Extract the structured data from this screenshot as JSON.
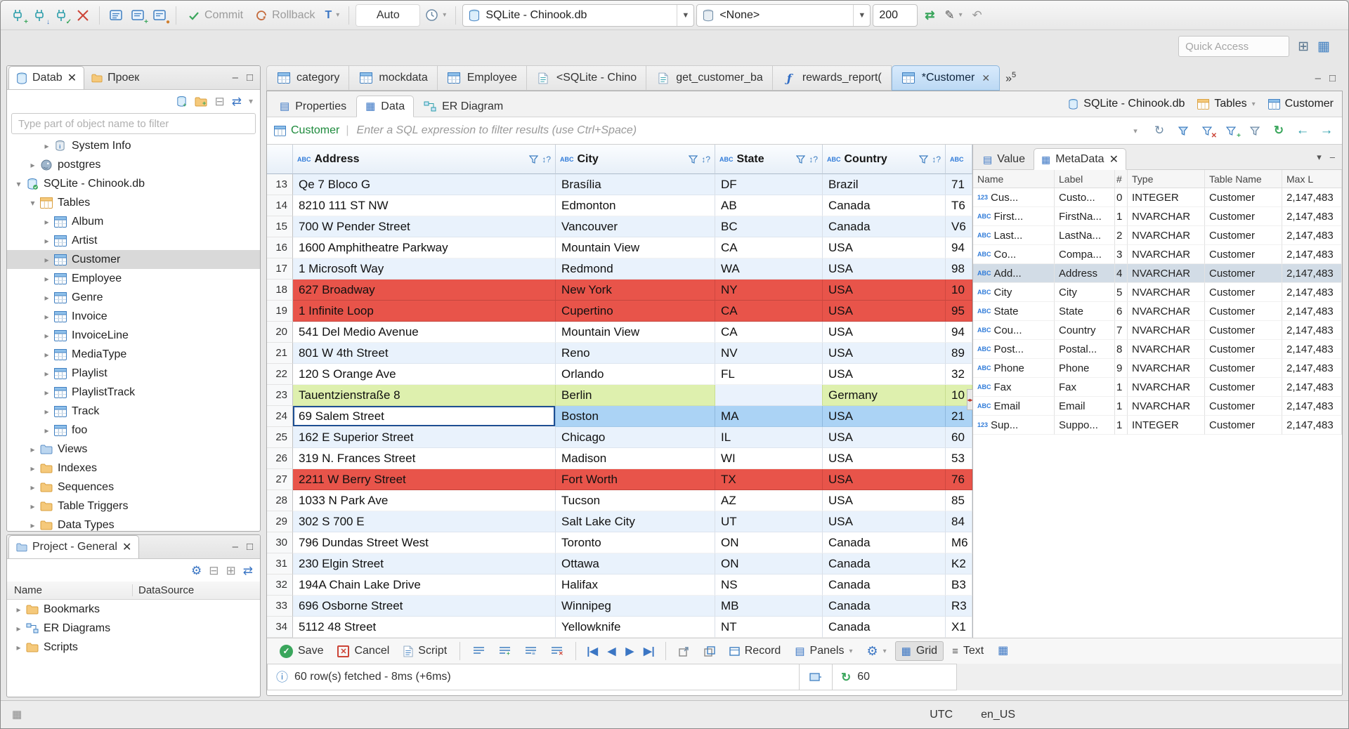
{
  "window": {
    "tz": "UTC",
    "locale": "en_US"
  },
  "icons": {
    "close": "✕",
    "caret": "▼",
    "caret_small": "▾",
    "minimize": "–",
    "maximize": "□",
    "chevron_right": "▸",
    "chevron_down": "▾",
    "first": "|◀",
    "prev": "◀",
    "next": "▶",
    "last": "▶|",
    "refresh": "↻",
    "gear": "⚙",
    "menu": "≡",
    "info": "ⓘ",
    "sort": "↕?",
    "back": "←",
    "forward": "→",
    "sync": "⇄",
    "link": "⇄",
    "collapse": "⊟",
    "expand": "⊞",
    "pencil": "✎",
    "undo": "↶",
    "plus": "+",
    "check": "✓",
    "divider": "|",
    "handle": "◂▸",
    "abc_chip": "ABC",
    "num_chip": "123",
    "clockface": "◷",
    "grid_glyph": "▦",
    "list_glyph": "▤",
    "record_glyph": "▭",
    "perspective": "⊞",
    "perspective2": "▦",
    "tiny_grid": "▦"
  },
  "toolbar": {
    "commit": "Commit",
    "rollback": "Rollback",
    "auto": "Auto",
    "connection": "SQLite - Chinook.db",
    "schema": "<None>",
    "fetch_size": "200",
    "quick_access": "Quick Access"
  },
  "navigator": {
    "tab_database": "Datab",
    "tab_projects": "Проек",
    "filter_placeholder": "Type part of object name to filter",
    "tree": [
      {
        "label": "System Info",
        "level": 2,
        "icon": "db-info",
        "arrow": "right"
      },
      {
        "label": "postgres",
        "level": 1,
        "icon": "postgres",
        "arrow": "right"
      },
      {
        "label": "SQLite - Chinook.db",
        "level": 0,
        "icon": "db-green",
        "arrow": "down"
      },
      {
        "label": "Tables",
        "level": 1,
        "icon": "table-folder",
        "arrow": "down"
      },
      {
        "label": "Album",
        "level": 2,
        "icon": "table",
        "arrow": "right"
      },
      {
        "label": "Artist",
        "level": 2,
        "icon": "table",
        "arrow": "right"
      },
      {
        "label": "Customer",
        "level": 2,
        "icon": "table",
        "arrow": "right",
        "selected": true
      },
      {
        "label": "Employee",
        "level": 2,
        "icon": "table",
        "arrow": "right"
      },
      {
        "label": "Genre",
        "level": 2,
        "icon": "table",
        "arrow": "right"
      },
      {
        "label": "Invoice",
        "level": 2,
        "icon": "table",
        "arrow": "right"
      },
      {
        "label": "InvoiceLine",
        "level": 2,
        "icon": "table",
        "arrow": "right"
      },
      {
        "label": "MediaType",
        "level": 2,
        "icon": "table",
        "arrow": "right"
      },
      {
        "label": "Playlist",
        "level": 2,
        "icon": "table",
        "arrow": "right"
      },
      {
        "label": "PlaylistTrack",
        "level": 2,
        "icon": "table",
        "arrow": "right"
      },
      {
        "label": "Track",
        "level": 2,
        "icon": "table",
        "arrow": "right"
      },
      {
        "label": "foo",
        "level": 2,
        "icon": "table",
        "arrow": "right"
      },
      {
        "label": "Views",
        "level": 1,
        "icon": "folder-blue",
        "arrow": "right"
      },
      {
        "label": "Indexes",
        "level": 1,
        "icon": "folder",
        "arrow": "right"
      },
      {
        "label": "Sequences",
        "level": 1,
        "icon": "folder",
        "arrow": "right"
      },
      {
        "label": "Table Triggers",
        "level": 1,
        "icon": "folder",
        "arrow": "right"
      },
      {
        "label": "Data Types",
        "level": 1,
        "icon": "folder",
        "arrow": "right"
      }
    ]
  },
  "project": {
    "tab": "Project - General",
    "col_name": "Name",
    "col_datasource": "DataSource",
    "items": [
      {
        "label": "Bookmarks",
        "icon": "folder"
      },
      {
        "label": "ER Diagrams",
        "icon": "erd"
      },
      {
        "label": "Scripts",
        "icon": "folder"
      }
    ]
  },
  "editor": {
    "tabs": [
      {
        "label": "category",
        "icon": "table"
      },
      {
        "label": "mockdata",
        "icon": "table"
      },
      {
        "label": "Employee",
        "icon": "table"
      },
      {
        "label": "<SQLite - Chino",
        "icon": "sql"
      },
      {
        "label": "get_customer_ba",
        "icon": "sql"
      },
      {
        "label": "rewards_report(",
        "icon": "func"
      },
      {
        "label": "*Customer",
        "icon": "table",
        "active": true,
        "close": true
      }
    ],
    "overflow_symbol": "»",
    "overflow_count": "5",
    "subtabs": {
      "properties": "Properties",
      "data": "Data",
      "er": "ER Diagram"
    },
    "breadcrumbs": {
      "connection": "SQLite - Chinook.db",
      "container": "Tables",
      "entity": "Customer"
    },
    "filter": {
      "entity": "Customer",
      "placeholder": "Enter a SQL expression to filter results (use Ctrl+Space)"
    }
  },
  "grid": {
    "columns": [
      "Address",
      "City",
      "State",
      "Country",
      ""
    ],
    "rows": [
      [
        13,
        "Qe 7 Bloco G",
        "Brasília",
        "DF",
        "Brazil",
        "71",
        ""
      ],
      [
        14,
        "8210 111 ST NW",
        "Edmonton",
        "AB",
        "Canada",
        "T6",
        ""
      ],
      [
        15,
        "700 W Pender Street",
        "Vancouver",
        "BC",
        "Canada",
        "V6",
        ""
      ],
      [
        16,
        "1600 Amphitheatre Parkway",
        "Mountain View",
        "CA",
        "USA",
        "94",
        ""
      ],
      [
        17,
        "1 Microsoft Way",
        "Redmond",
        "WA",
        "USA",
        "98",
        ""
      ],
      [
        18,
        "627 Broadway",
        "New York",
        "NY",
        "USA",
        "10",
        "red"
      ],
      [
        19,
        "1 Infinite Loop",
        "Cupertino",
        "CA",
        "USA",
        "95",
        "red"
      ],
      [
        20,
        "541 Del Medio Avenue",
        "Mountain View",
        "CA",
        "USA",
        "94",
        ""
      ],
      [
        21,
        "801 W 4th Street",
        "Reno",
        "NV",
        "USA",
        "89",
        ""
      ],
      [
        22,
        "120 S Orange Ave",
        "Orlando",
        "FL",
        "USA",
        "32",
        ""
      ],
      [
        23,
        "Tauentzienstraße 8",
        "Berlin",
        "",
        "Germany",
        "10",
        "green"
      ],
      [
        24,
        "69 Salem Street",
        "Boston",
        "MA",
        "USA",
        "21",
        "sel"
      ],
      [
        25,
        "162 E Superior Street",
        "Chicago",
        "IL",
        "USA",
        "60",
        ""
      ],
      [
        26,
        "319 N. Frances Street",
        "Madison",
        "WI",
        "USA",
        "53",
        ""
      ],
      [
        27,
        "2211 W Berry Street",
        "Fort Worth",
        "TX",
        "USA",
        "76",
        "red"
      ],
      [
        28,
        "1033 N Park Ave",
        "Tucson",
        "AZ",
        "USA",
        "85",
        ""
      ],
      [
        29,
        "302 S 700 E",
        "Salt Lake City",
        "UT",
        "USA",
        "84",
        ""
      ],
      [
        30,
        "796 Dundas Street West",
        "Toronto",
        "ON",
        "Canada",
        "M6",
        ""
      ],
      [
        31,
        "230 Elgin Street",
        "Ottawa",
        "ON",
        "Canada",
        "K2",
        ""
      ],
      [
        32,
        "194A Chain Lake Drive",
        "Halifax",
        "NS",
        "Canada",
        "B3",
        ""
      ],
      [
        33,
        "696 Osborne Street",
        "Winnipeg",
        "MB",
        "Canada",
        "R3",
        ""
      ],
      [
        34,
        "5112 48 Street",
        "Yellowknife",
        "NT",
        "Canada",
        "X1",
        ""
      ]
    ]
  },
  "metadata": {
    "tab_value": "Value",
    "tab_metadata": "MetaData",
    "columns": [
      "Name",
      "Label",
      "#",
      "Type",
      "Table Name",
      "Max L"
    ],
    "rows": [
      {
        "kind": "123",
        "name": "Cus...",
        "label": "Custo...",
        "num": "0",
        "type": "INTEGER",
        "table": "Customer",
        "max": "2,147,483",
        "selected": false
      },
      {
        "kind": "ABC",
        "name": "First...",
        "label": "FirstNa...",
        "num": "1",
        "type": "NVARCHAR",
        "table": "Customer",
        "max": "2,147,483",
        "selected": false
      },
      {
        "kind": "ABC",
        "name": "Last...",
        "label": "LastNa...",
        "num": "2",
        "type": "NVARCHAR",
        "table": "Customer",
        "max": "2,147,483",
        "selected": false
      },
      {
        "kind": "ABC",
        "name": "Co...",
        "label": "Compa...",
        "num": "3",
        "type": "NVARCHAR",
        "table": "Customer",
        "max": "2,147,483",
        "selected": false
      },
      {
        "kind": "ABC",
        "name": "Add...",
        "label": "Address",
        "num": "4",
        "type": "NVARCHAR",
        "table": "Customer",
        "max": "2,147,483",
        "selected": true
      },
      {
        "kind": "ABC",
        "name": "City",
        "label": "City",
        "num": "5",
        "type": "NVARCHAR",
        "table": "Customer",
        "max": "2,147,483",
        "selected": false
      },
      {
        "kind": "ABC",
        "name": "State",
        "label": "State",
        "num": "6",
        "type": "NVARCHAR",
        "table": "Customer",
        "max": "2,147,483",
        "selected": false
      },
      {
        "kind": "ABC",
        "name": "Cou...",
        "label": "Country",
        "num": "7",
        "type": "NVARCHAR",
        "table": "Customer",
        "max": "2,147,483",
        "selected": false
      },
      {
        "kind": "ABC",
        "name": "Post...",
        "label": "Postal...",
        "num": "8",
        "type": "NVARCHAR",
        "table": "Customer",
        "max": "2,147,483",
        "selected": false
      },
      {
        "kind": "ABC",
        "name": "Phone",
        "label": "Phone",
        "num": "9",
        "type": "NVARCHAR",
        "table": "Customer",
        "max": "2,147,483",
        "selected": false
      },
      {
        "kind": "ABC",
        "name": "Fax",
        "label": "Fax",
        "num": "1",
        "type": "NVARCHAR",
        "table": "Customer",
        "max": "2,147,483",
        "selected": false
      },
      {
        "kind": "ABC",
        "name": "Email",
        "label": "Email",
        "num": "1",
        "type": "NVARCHAR",
        "table": "Customer",
        "max": "2,147,483",
        "selected": false
      },
      {
        "kind": "123",
        "name": "Sup...",
        "label": "Suppo...",
        "num": "1",
        "type": "INTEGER",
        "table": "Customer",
        "max": "2,147,483",
        "selected": false
      }
    ]
  },
  "result_toolbar": {
    "save": "Save",
    "cancel": "Cancel",
    "script": "Script",
    "record": "Record",
    "panels": "Panels",
    "grid": "Grid",
    "text": "Text"
  },
  "status": {
    "fetch_info": "60 row(s) fetched - 8ms (+6ms)",
    "auto_refresh_value": "60"
  }
}
